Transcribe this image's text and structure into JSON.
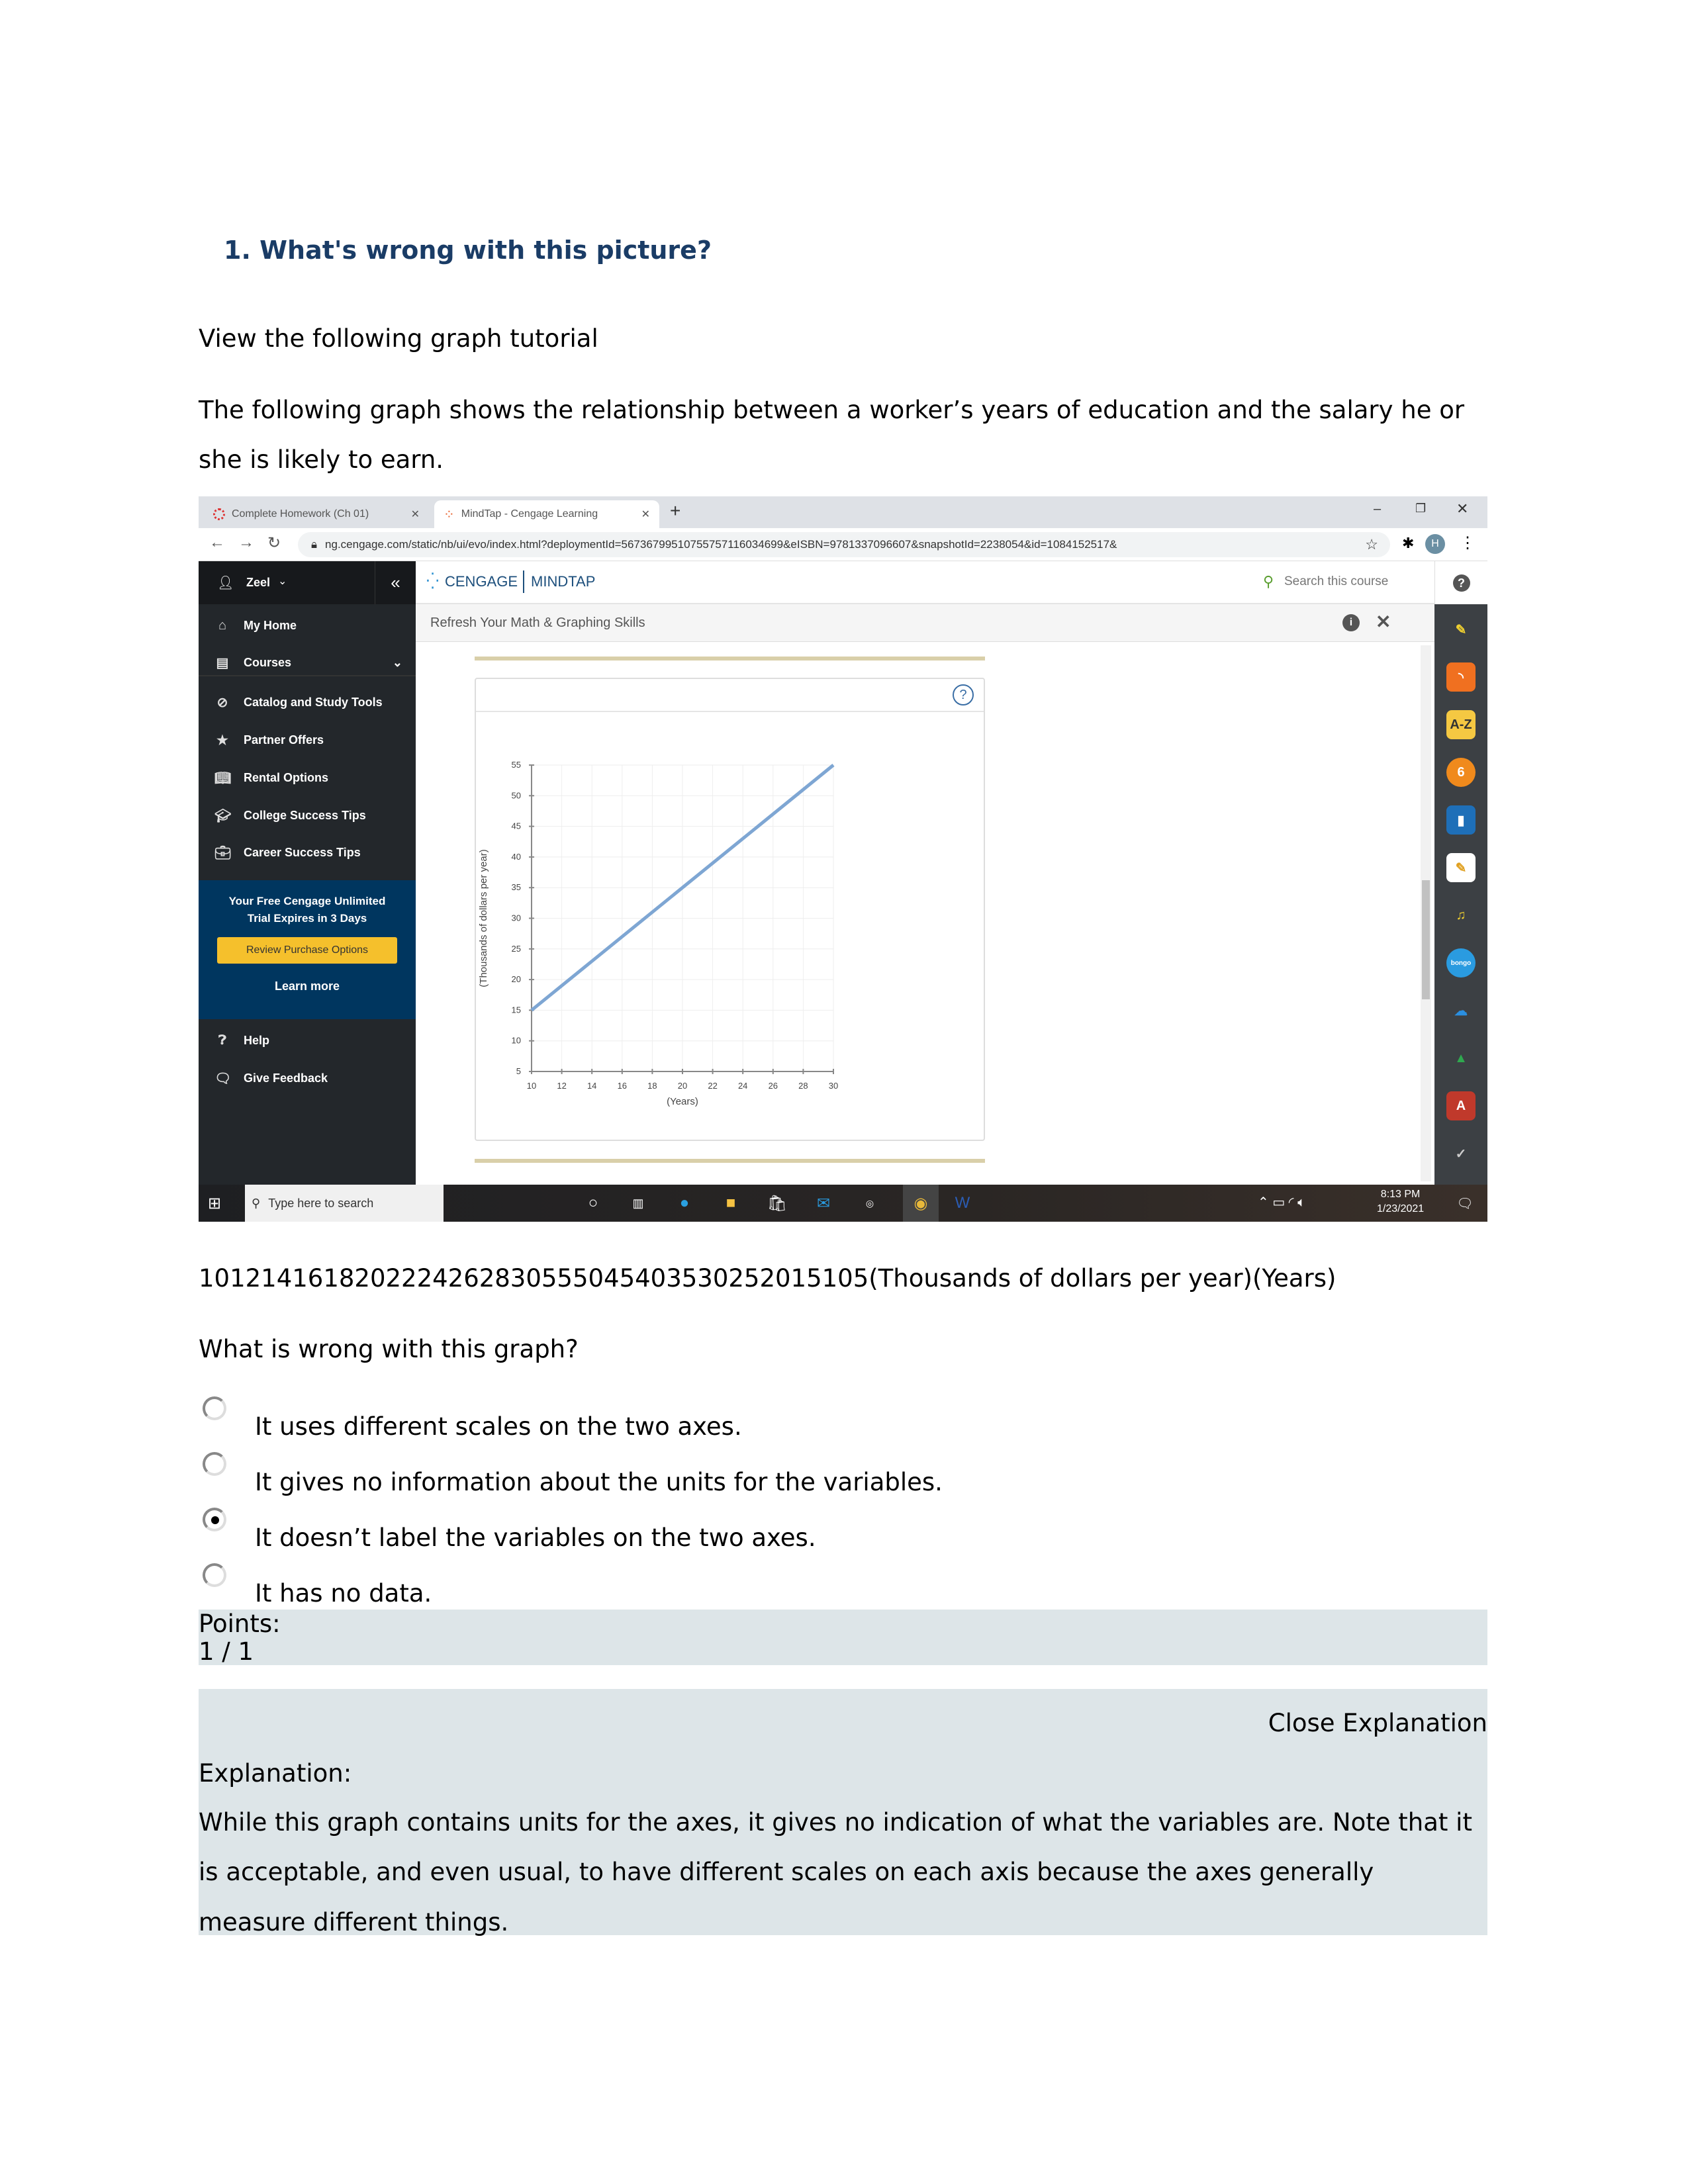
{
  "question": {
    "title": "1. What's wrong with this picture?",
    "intro": "View the following graph tutorial",
    "description_line1": "The following graph shows the relationship between a worker’s years of education and the salary he or",
    "description_line2": "she is likely to earn.",
    "flattened_chart_text": "1012141618202224262830555045403530252015105(Thousands of dollars per year)(Years)",
    "prompt": "What is wrong with this graph?",
    "options": [
      {
        "label": "It uses different scales on the two axes.",
        "selected": false
      },
      {
        "label": "It gives no information about the units for the variables.",
        "selected": false
      },
      {
        "label": "It doesn’t label the variables on the two axes.",
        "selected": true
      },
      {
        "label": "It has no data.",
        "selected": false
      }
    ],
    "points_label": "Points:",
    "points_value": "1 / 1",
    "close_explanation": "Close Explanation",
    "explanation_label": "Explanation:",
    "explanation_lines": [
      "While this graph contains units for the axes, it gives no indication of what the variables are. Note that it",
      "is acceptable, and even usual, to have different scales on each axis because the axes generally",
      "measure different things."
    ]
  },
  "browser": {
    "tabs": [
      {
        "label": "Complete Homework (Ch 01)",
        "icon": "cengage-ring-icon"
      },
      {
        "label": "MindTap - Cengage Learning",
        "icon": "mindtap-icon"
      }
    ],
    "new_tab": "+",
    "url": "ng.cengage.com/static/nb/ui/evo/index.html?deploymentId=5673679951075575711603469​9&eISBN=9781337096607&snapshotId=2238054&id=1084152517&",
    "profile_initial": "H"
  },
  "app": {
    "user": "Zeel",
    "brand_left": "CENGAGE",
    "brand_right": "MINDTAP",
    "search_placeholder": "Search this course",
    "panel_title": "Refresh Your Math & Graphing Skills",
    "sidebar": [
      {
        "label": "My Home",
        "icon": "home-icon"
      },
      {
        "label": "Courses",
        "icon": "book-icon"
      },
      {
        "label": "Catalog and Study Tools",
        "icon": "compass-icon"
      },
      {
        "label": "Partner Offers",
        "icon": "star-icon"
      },
      {
        "label": "Rental Options",
        "icon": "open-book-icon"
      },
      {
        "label": "College Success Tips",
        "icon": "graduation-cap-icon"
      },
      {
        "label": "Career Success Tips",
        "icon": "briefcase-icon"
      }
    ],
    "promo_line1": "Your Free Cengage Unlimited",
    "promo_line2": "Trial Expires in 3 Days",
    "promo_button": "Review Purchase Options",
    "learn_more": "Learn more",
    "help": "Help",
    "feedback": "Give Feedback",
    "toolbar_icons": [
      "highlighter-icon",
      "rss-icon",
      "a-z-glossary-icon",
      "cengage-6-icon",
      "notebook-icon",
      "notepad-icon",
      "readspeaker-icon",
      "bongo-icon",
      "onedrive-icon",
      "google-drive-icon",
      "adobe-icon",
      "check-icon"
    ],
    "accent": "#f5c02c",
    "sidebar_bg": "#23272b",
    "promo_bg": "#00365f"
  },
  "taskbar": {
    "search_placeholder": "Type here to search",
    "time": "8:13 PM",
    "date": "1/23/2021"
  },
  "chart_data": {
    "type": "line",
    "title": "",
    "xlabel": "(Years)",
    "ylabel": "(Thousands of dollars per year)",
    "xlim": [
      10,
      30
    ],
    "ylim": [
      5,
      55
    ],
    "xticks": [
      10,
      12,
      14,
      16,
      18,
      20,
      22,
      24,
      26,
      28,
      30
    ],
    "yticks": [
      5,
      10,
      15,
      20,
      25,
      30,
      35,
      40,
      45,
      50,
      55
    ],
    "grid": true,
    "series": [
      {
        "x": [
          10,
          30
        ],
        "y": [
          15,
          55
        ],
        "color": "#7ea6d3"
      }
    ]
  }
}
